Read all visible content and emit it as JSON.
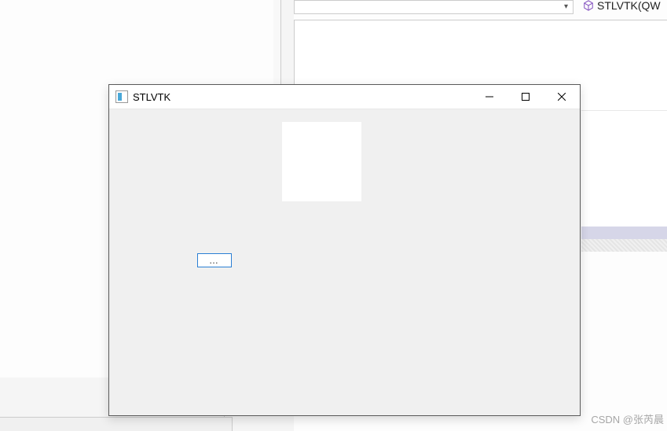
{
  "background": {
    "top_label": "STLVTK(QW",
    "combo_arrow": "▾"
  },
  "dialog": {
    "title": "STLVTK",
    "buttons": {
      "ellipsis_label": "…"
    }
  },
  "watermark": "CSDN @张芮晨"
}
